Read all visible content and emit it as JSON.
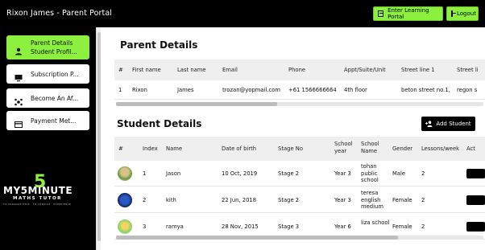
{
  "header": {
    "title": "Rixon James - Parent Portal",
    "learning_button": "Enter Learning Portal",
    "logout_button": "Logout"
  },
  "sidebar": {
    "items": [
      {
        "label": "Parent Details Student Profil...",
        "icon": "user-icon",
        "active": true
      },
      {
        "label": "Subscription P...",
        "icon": "monitor-icon",
        "active": false
      },
      {
        "label": "Become An Af...",
        "icon": "affiliate-icon",
        "active": false
      },
      {
        "label": "Payment Met...",
        "icon": "card-icon",
        "active": false
      }
    ],
    "logo": {
      "text": "MY5MINUTE",
      "sub": "MATHS TUTOR",
      "tagline": "TO ARRANGE HELP · TO CONSULT · EXPERIENCE"
    }
  },
  "parent_details": {
    "title": "Parent Details",
    "columns": [
      "#",
      "First name",
      "Last name",
      "Email",
      "Phone",
      "Appt/Suite/Unit",
      "Street line 1",
      "Street li"
    ],
    "rows": [
      [
        "1",
        "Rixon",
        "James",
        "trozan@yopmail.com",
        "+61 1566666664",
        "4th floor",
        "beton street no.1,",
        "regon s"
      ]
    ]
  },
  "student_details": {
    "title": "Student Details",
    "add_button": "Add Student",
    "columns": [
      "#",
      "Index",
      "Name",
      "Date of birth",
      "Stage No",
      "School year",
      "School Name",
      "Gender",
      "Lessons/week",
      "Act"
    ],
    "rows": [
      {
        "index": "1",
        "name": "Jason",
        "dob": "10 Oct, 2019",
        "stage": "Stage 2",
        "year": "Year 3",
        "school": "tohan public school",
        "gender": "Male",
        "lessons": "2"
      },
      {
        "index": "2",
        "name": "kith",
        "dob": "22 Jun, 2018",
        "stage": "Stage 2",
        "year": "Year 3",
        "school": "teresa english medium",
        "gender": "Female",
        "lessons": "2"
      },
      {
        "index": "3",
        "name": "ramya",
        "dob": "28 Nov, 2015",
        "stage": "Stage 3",
        "year": "Year 6",
        "school": "liza school",
        "gender": "Female",
        "lessons": "2"
      }
    ]
  },
  "colors": {
    "accent": "#8ef03e",
    "background": "#000000",
    "header_row": "#efefef"
  }
}
